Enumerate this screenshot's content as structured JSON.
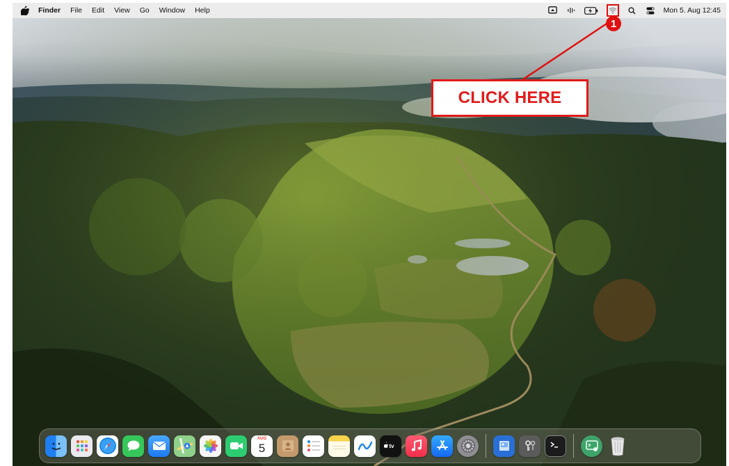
{
  "menubar": {
    "app_name": "Finder",
    "menus": [
      "File",
      "Edit",
      "View",
      "Go",
      "Window",
      "Help"
    ],
    "clock": "Mon 5. Aug 12:45",
    "status_icons": [
      "screen-mirroring-icon",
      "audio-icon",
      "battery-icon",
      "wifi-icon",
      "spotlight-search-icon",
      "control-center-icon"
    ]
  },
  "annotation": {
    "callout_text": "CLICK HERE",
    "step_number": "1",
    "color": "#e01010"
  },
  "calendar_icon": {
    "month": "AUG",
    "day": "5"
  },
  "dock": {
    "apps": [
      {
        "name": "finder",
        "icon": "finder-icon",
        "color": "#2f8ef0"
      },
      {
        "name": "launchpad",
        "icon": "launchpad-icon",
        "color": "#e9e9ee"
      },
      {
        "name": "safari",
        "icon": "safari-icon",
        "color": "#1e88e5"
      },
      {
        "name": "messages",
        "icon": "messages-icon",
        "color": "#35c759"
      },
      {
        "name": "mail",
        "icon": "mail-icon",
        "color": "#2f8ef5"
      },
      {
        "name": "maps",
        "icon": "maps-icon",
        "color": "#7bc47f"
      },
      {
        "name": "photos",
        "icon": "photos-icon",
        "color": "#f2f2f2"
      },
      {
        "name": "facetime",
        "icon": "facetime-icon",
        "color": "#2ecc71"
      },
      {
        "name": "calendar",
        "icon": "calendar-icon",
        "color": "#ffffff"
      },
      {
        "name": "contacts",
        "icon": "contacts-icon",
        "color": "#b98a5e"
      },
      {
        "name": "reminders",
        "icon": "reminders-icon",
        "color": "#ffffff"
      },
      {
        "name": "notes",
        "icon": "notes-icon",
        "color": "#fff6c2"
      },
      {
        "name": "freeform",
        "icon": "freeform-icon",
        "color": "#ffffff"
      },
      {
        "name": "apple-tv",
        "icon": "apple-tv-icon",
        "color": "#111111"
      },
      {
        "name": "music",
        "icon": "music-icon",
        "color": "#fa3c55"
      },
      {
        "name": "app-store",
        "icon": "app-store-icon",
        "color": "#1e8cf5"
      },
      {
        "name": "system-settings",
        "icon": "gear-icon",
        "color": "#8e8e93"
      },
      {
        "name": "preview",
        "icon": "preview-icon",
        "color": "#2a6fd6"
      },
      {
        "name": "keychain-access",
        "icon": "keys-icon",
        "color": "#5b5b5b"
      },
      {
        "name": "terminal",
        "icon": "terminal-icon",
        "color": "#1c1c1c"
      },
      {
        "name": "script-editor",
        "icon": "script-icon",
        "color": "#3fa36a"
      },
      {
        "name": "trash",
        "icon": "trash-icon",
        "color": "#e6e6e6"
      }
    ]
  }
}
